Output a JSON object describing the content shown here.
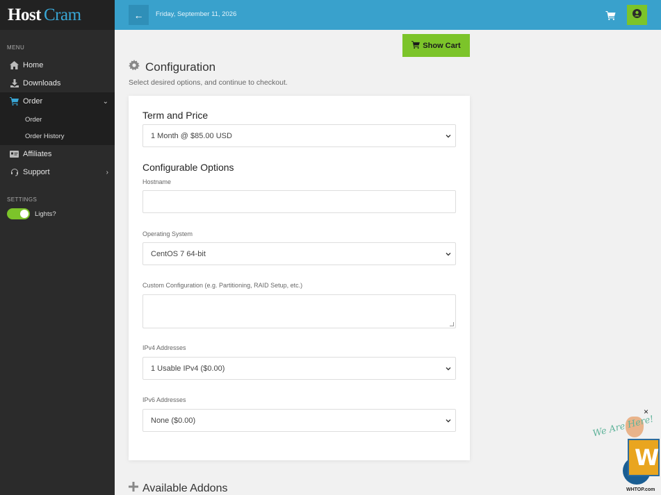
{
  "brand": {
    "part1": "Host",
    "part2": "Cram"
  },
  "sidebar": {
    "menu_label": "MENU",
    "items": [
      {
        "label": "Home",
        "icon": "home-icon"
      },
      {
        "label": "Downloads",
        "icon": "download-icon"
      },
      {
        "label": "Order",
        "icon": "cart-icon"
      },
      {
        "label": "Affiliates",
        "icon": "id-card-icon"
      },
      {
        "label": "Support",
        "icon": "headset-icon"
      }
    ],
    "order_sub": [
      "Order",
      "Order History"
    ],
    "settings_label": "SETTINGS",
    "toggle_label": "Lights?"
  },
  "topbar": {
    "back_symbol": "←",
    "date": "Friday, September 11, 2026"
  },
  "main": {
    "show_cart": "Show Cart",
    "title": "Configuration",
    "subtitle": "Select desired options, and continue to checkout.",
    "term_heading": "Term and Price",
    "term_value": "1 Month @ $85.00 USD",
    "options_heading": "Configurable Options",
    "fields": {
      "hostname": {
        "label": "Hostname",
        "value": ""
      },
      "os": {
        "label": "Operating System",
        "value": "CentOS 7 64-bit"
      },
      "custom": {
        "label": "Custom Configuration (e.g. Partitioning, RAID Setup, etc.)",
        "value": ""
      },
      "ipv4": {
        "label": "IPv4 Addresses",
        "value": "1 Usable IPv4 ($0.00)"
      },
      "ipv6": {
        "label": "IPv6 Addresses",
        "value": "None ($0.00)"
      }
    },
    "addons_heading": "Available Addons"
  },
  "widget": {
    "close": "×",
    "text": "We Are Here!",
    "footer": "WHTOP.com"
  },
  "colors": {
    "accent_blue": "#39a1cc",
    "accent_green": "#7cc42a",
    "sidebar_bg": "#2b2b2b"
  }
}
